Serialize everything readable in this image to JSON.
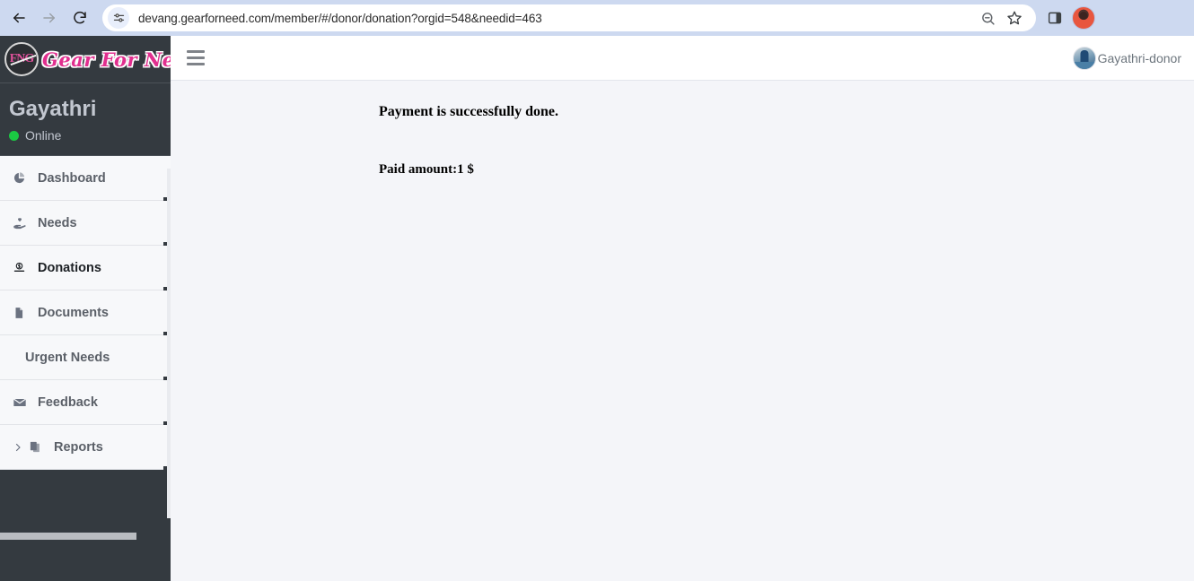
{
  "browser": {
    "back_label": "Back",
    "forward_label": "Forward",
    "reload_label": "Reload",
    "site_info_icon": "tune-icon",
    "url": "devang.gearforneed.com/member/#/donor/donation?orgid=548&needid=463",
    "zoom_icon": "zoom-out-icon",
    "bookmark_icon": "star-icon",
    "side_panel_icon": "side-panel-icon",
    "profile_icon": "profile-avatar",
    "toolbar_color": "#cdd9f0"
  },
  "sidebar": {
    "brand": {
      "badge_text": "FNG",
      "title": "Gear For Need",
      "title_color": "#e12f8f"
    },
    "user": {
      "name": "Gayathri",
      "status": "Online",
      "status_color": "#1bc943"
    },
    "items": [
      {
        "label": "Dashboard",
        "icon": "pie-chart-icon",
        "active": false,
        "has_icon": true,
        "has_chevron": false
      },
      {
        "label": "Needs",
        "icon": "hand-heart-icon",
        "active": false,
        "has_icon": true,
        "has_chevron": false
      },
      {
        "label": "Donations",
        "icon": "donate-icon",
        "active": true,
        "has_icon": true,
        "has_chevron": false
      },
      {
        "label": "Documents",
        "icon": "file-icon",
        "active": false,
        "has_icon": true,
        "has_chevron": false
      },
      {
        "label": "Urgent Needs",
        "icon": "",
        "active": false,
        "has_icon": false,
        "has_chevron": false
      },
      {
        "label": "Feedback",
        "icon": "envelope-icon",
        "active": false,
        "has_icon": true,
        "has_chevron": false
      },
      {
        "label": "Reports",
        "icon": "copy-files-icon",
        "active": false,
        "has_icon": true,
        "has_chevron": true
      }
    ],
    "background_color": "#343a40"
  },
  "topbar": {
    "menu_toggle_icon": "hamburger-icon",
    "account_name": "Gayathri-donor",
    "account_avatar_icon": "user-avatar"
  },
  "main": {
    "payment_message": "Payment is successfully done.",
    "paid_amount": "Paid amount:1 $",
    "background_color": "#f4f5f9"
  }
}
